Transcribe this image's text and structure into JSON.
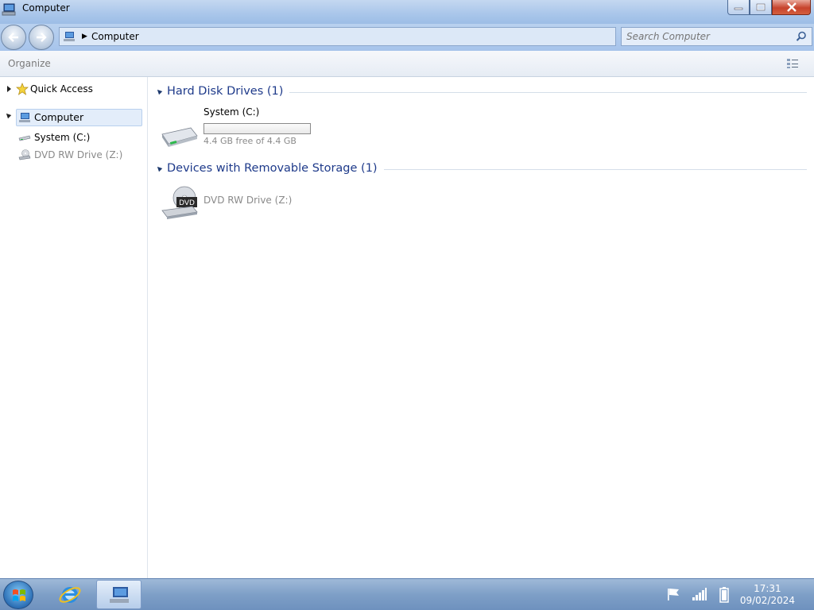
{
  "window": {
    "title": "Computer"
  },
  "address": {
    "crumb": "Computer"
  },
  "search": {
    "placeholder": "Search Computer"
  },
  "toolbar": {
    "organize_label": "Organize"
  },
  "navpane": {
    "quick_access": "Quick Access",
    "computer": "Computer",
    "system_drive": "System (C:)",
    "dvd_drive": "DVD RW Drive (Z:)"
  },
  "content": {
    "groups": [
      {
        "title": "Hard Disk Drives (1)"
      },
      {
        "title": "Devices with Removable Storage (1)"
      }
    ],
    "system_drive": {
      "name": "System (C:)",
      "free_text": "4.4 GB free of 4.4 GB",
      "used_fraction": 0.0
    },
    "dvd_drive": {
      "name": "DVD RW Drive (Z:)",
      "label": "DVD"
    }
  },
  "taskbar": {
    "time": "17:31",
    "date": "09/02/2024"
  },
  "colors": {
    "group_title": "#1e3a8a",
    "selection": "#e3edfa",
    "taskbar": "#7e9fc7"
  }
}
